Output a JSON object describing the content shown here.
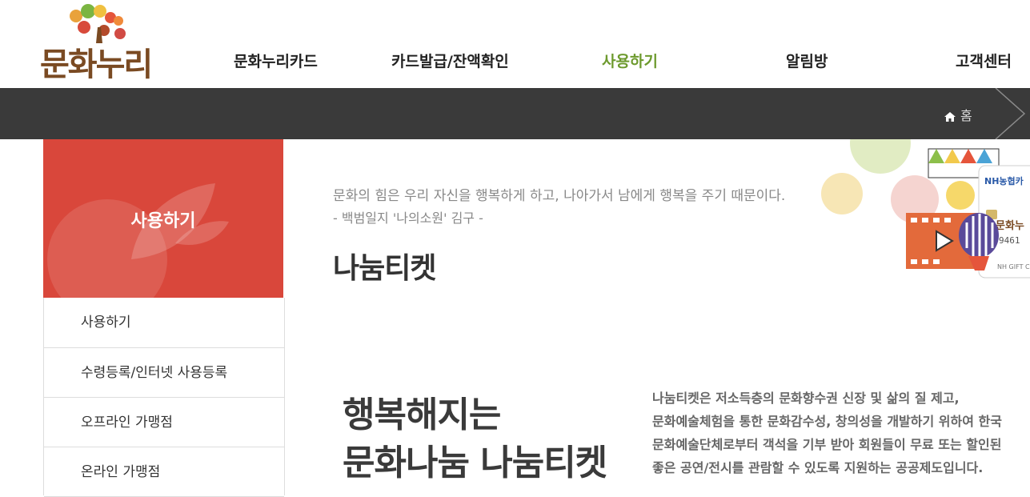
{
  "header": {
    "logo_text": "문화누리",
    "nav": [
      {
        "label": "문화누리카드"
      },
      {
        "label": "카드발급/잔액확인"
      },
      {
        "label": "사용하기"
      },
      {
        "label": "알림방"
      },
      {
        "label": "고객센터"
      }
    ],
    "active_nav": "사용하기"
  },
  "breadcrumb": {
    "home": "홈"
  },
  "sidebar": {
    "title": "사용하기",
    "items": [
      {
        "label": "사용하기"
      },
      {
        "label": "수령등록/인터넷 사용등록"
      },
      {
        "label": "오프라인 가맹점"
      },
      {
        "label": "온라인 가맹점"
      }
    ]
  },
  "main": {
    "quote_line1": "문화의 힘은 우리 자신을 행복하게 하고, 나아가서 남에게 행복을 주기 때문이다.",
    "quote_line2": "- 백범일지 '나의소원' 김구 -",
    "page_title": "나눔티켓",
    "banner_line1": "행복해지는",
    "banner_line2": "문화나눔 나눔티켓",
    "description": [
      "나눔티켓은 저소득층의 문화향수권 신장 및 삶의 질 제고,",
      "문화예술체험을 통한 문화감수성, 창의성을 개발하기 위하여 한국",
      "문화예술단체로부터 객석을 기부 받아 회원들이 무료 또는 할인된",
      "좋은 공연/전시를 관람할 수 있도록 지원하는 공공제도입니다."
    ],
    "card_brand": "NH농협카",
    "card_logo": "문화누",
    "card_number": "9461",
    "card_small": "NH GIFT C"
  },
  "colors": {
    "accent_red": "#d9473b",
    "nav_active": "#6d9a2e",
    "topbar": "#3a3a3a"
  },
  "icons": [
    "home-icon",
    "chevron-right-icon"
  ]
}
